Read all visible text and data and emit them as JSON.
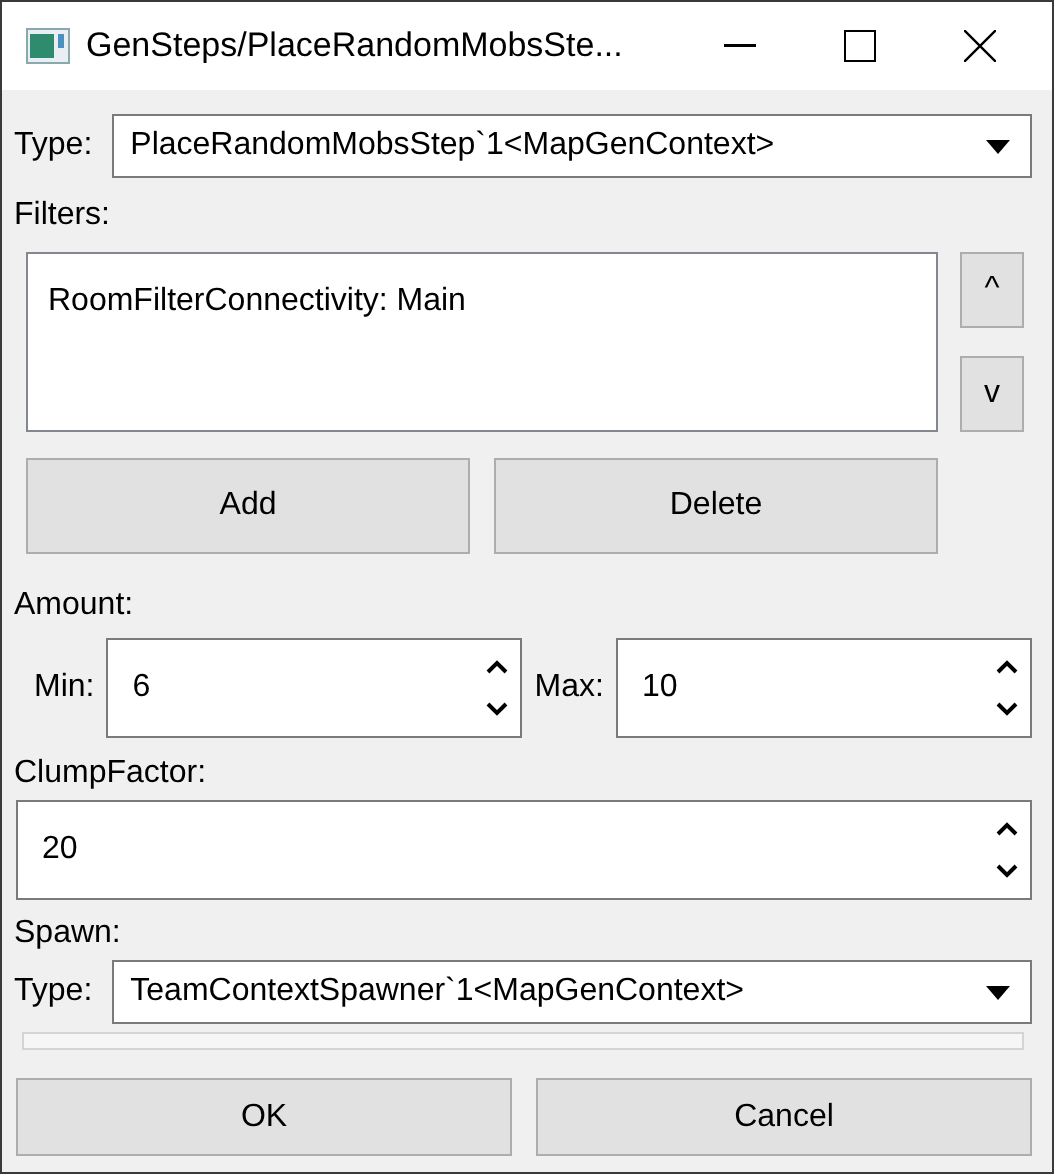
{
  "window": {
    "title": "GenSteps/PlaceRandomMobsSte..."
  },
  "type": {
    "label": "Type:",
    "value": "PlaceRandomMobsStep`1<MapGenContext>"
  },
  "filters": {
    "label": "Filters:",
    "items": [
      {
        "text": "RoomFilterConnectivity: Main"
      }
    ],
    "move_up": "^",
    "move_down": "v",
    "add": "Add",
    "delete": "Delete"
  },
  "amount": {
    "label": "Amount:",
    "min_label": "Min:",
    "min_value": "6",
    "max_label": "Max:",
    "max_value": "10"
  },
  "clump_factor": {
    "label": "ClumpFactor:",
    "value": "20"
  },
  "spawn": {
    "label": "Spawn:",
    "type_label": "Type:",
    "type_value": "TeamContextSpawner`1<MapGenContext>"
  },
  "buttons": [
    "OK",
    "Cancel"
  ]
}
